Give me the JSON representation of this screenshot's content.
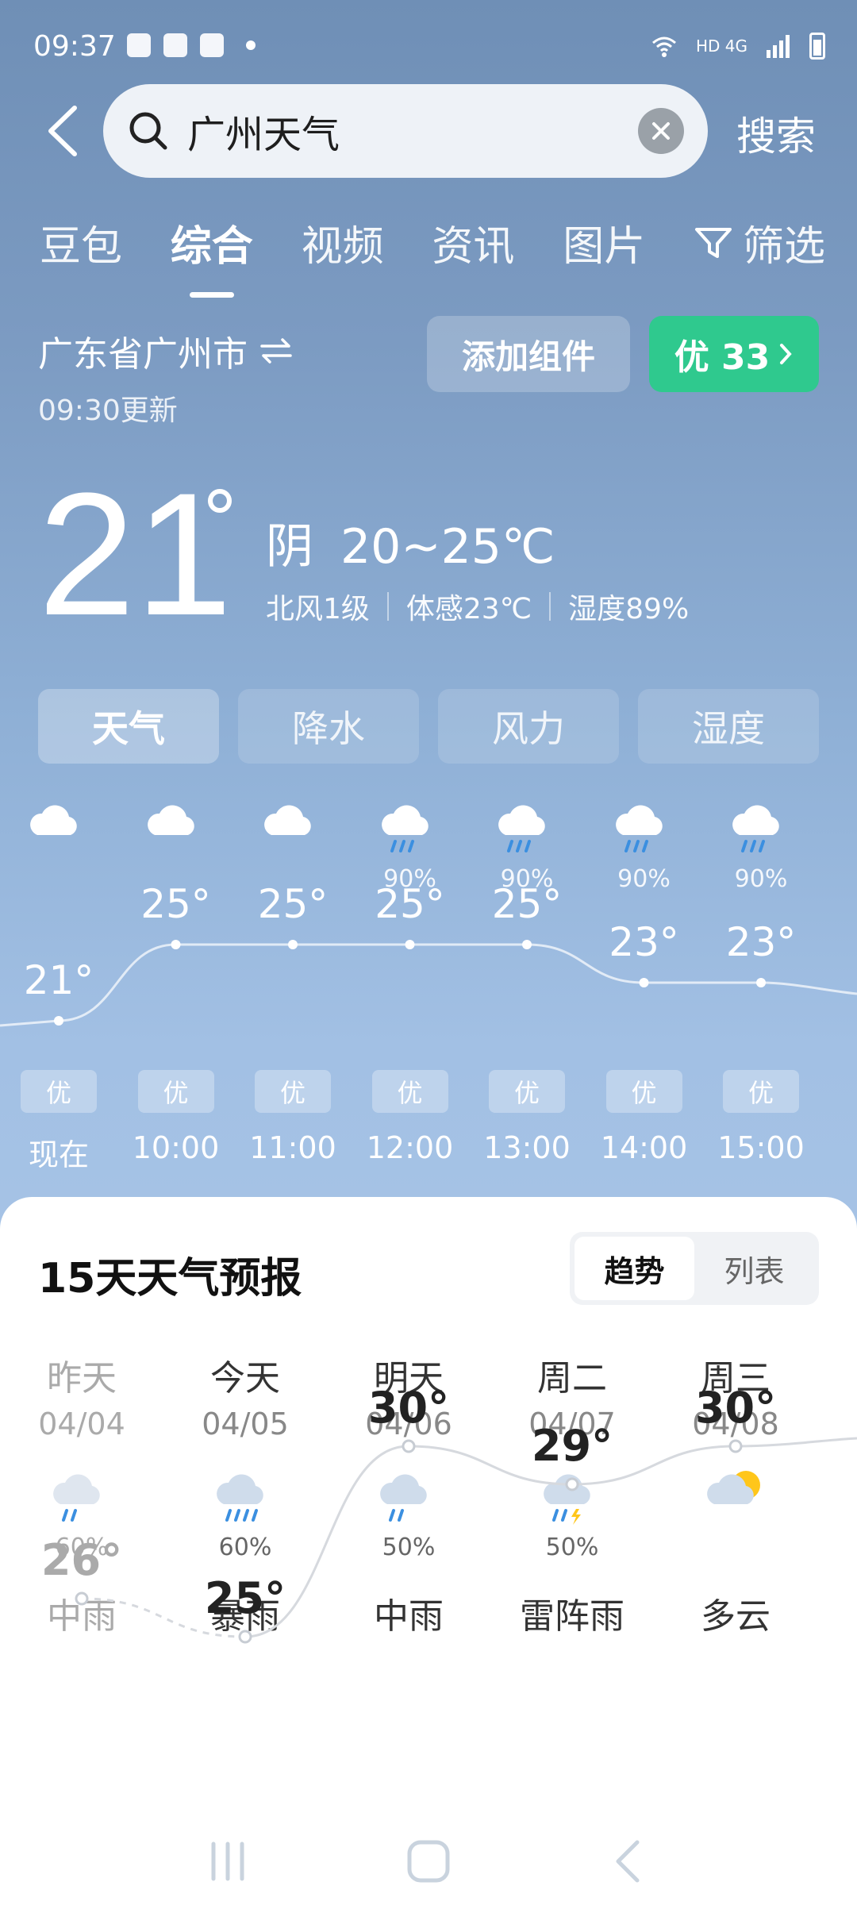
{
  "status_bar": {
    "time": "09:37",
    "network": "HD 4G"
  },
  "search": {
    "query": "广州天气",
    "button_label": "搜索"
  },
  "tabs": [
    {
      "label": "豆包"
    },
    {
      "label": "综合",
      "active": true
    },
    {
      "label": "视频"
    },
    {
      "label": "资讯"
    },
    {
      "label": "图片"
    },
    {
      "label": "筛选"
    }
  ],
  "location": {
    "name": "广东省广州市",
    "updated": "09:30更新"
  },
  "buttons": {
    "add_widget": "添加组件",
    "aqi": "优 33"
  },
  "current": {
    "temp": "21",
    "condition": "阴",
    "range": "20~25℃",
    "wind": "北风1级",
    "feels_like": "体感23℃",
    "humidity": "湿度89%"
  },
  "segments": [
    "天气",
    "降水",
    "风力",
    "湿度"
  ],
  "hourly": [
    {
      "time": "现在",
      "temp": "21°",
      "pop": "",
      "icon": "cloud-icon",
      "aqi": "优",
      "t": 21
    },
    {
      "time": "10:00",
      "temp": "25°",
      "pop": "",
      "icon": "cloud-icon",
      "aqi": "优",
      "t": 25
    },
    {
      "time": "11:00",
      "temp": "25°",
      "pop": "",
      "icon": "cloud-icon",
      "aqi": "优",
      "t": 25
    },
    {
      "time": "12:00",
      "temp": "25°",
      "pop": "90%",
      "icon": "rain-icon",
      "aqi": "优",
      "t": 25
    },
    {
      "time": "13:00",
      "temp": "25°",
      "pop": "90%",
      "icon": "rain-icon",
      "aqi": "优",
      "t": 25
    },
    {
      "time": "14:00",
      "temp": "23°",
      "pop": "90%",
      "icon": "rain-icon",
      "aqi": "优",
      "t": 23
    },
    {
      "time": "15:00",
      "temp": "23°",
      "pop": "90%",
      "icon": "rain-icon",
      "aqi": "优",
      "t": 23
    }
  ],
  "forecast": {
    "title": "15天天气预报",
    "toggle": [
      "趋势",
      "列表"
    ],
    "days": [
      {
        "name": "昨天",
        "date": "04/04",
        "pop": "60%",
        "cond": "中雨",
        "temp": "26°",
        "icon": "rain-icon",
        "t": 26,
        "past": true
      },
      {
        "name": "今天",
        "date": "04/05",
        "pop": "60%",
        "cond": "暴雨",
        "temp": "25°",
        "icon": "heavy-rain-icon",
        "t": 25
      },
      {
        "name": "明天",
        "date": "04/06",
        "pop": "50%",
        "cond": "中雨",
        "temp": "30°",
        "icon": "rain-icon",
        "t": 30
      },
      {
        "name": "周二",
        "date": "04/07",
        "pop": "50%",
        "cond": "雷阵雨",
        "temp": "29°",
        "icon": "thunder-icon",
        "t": 29
      },
      {
        "name": "周三",
        "date": "04/08",
        "pop": "",
        "cond": "多云",
        "temp": "30°",
        "icon": "partly-cloudy-icon",
        "t": 30
      }
    ]
  }
}
